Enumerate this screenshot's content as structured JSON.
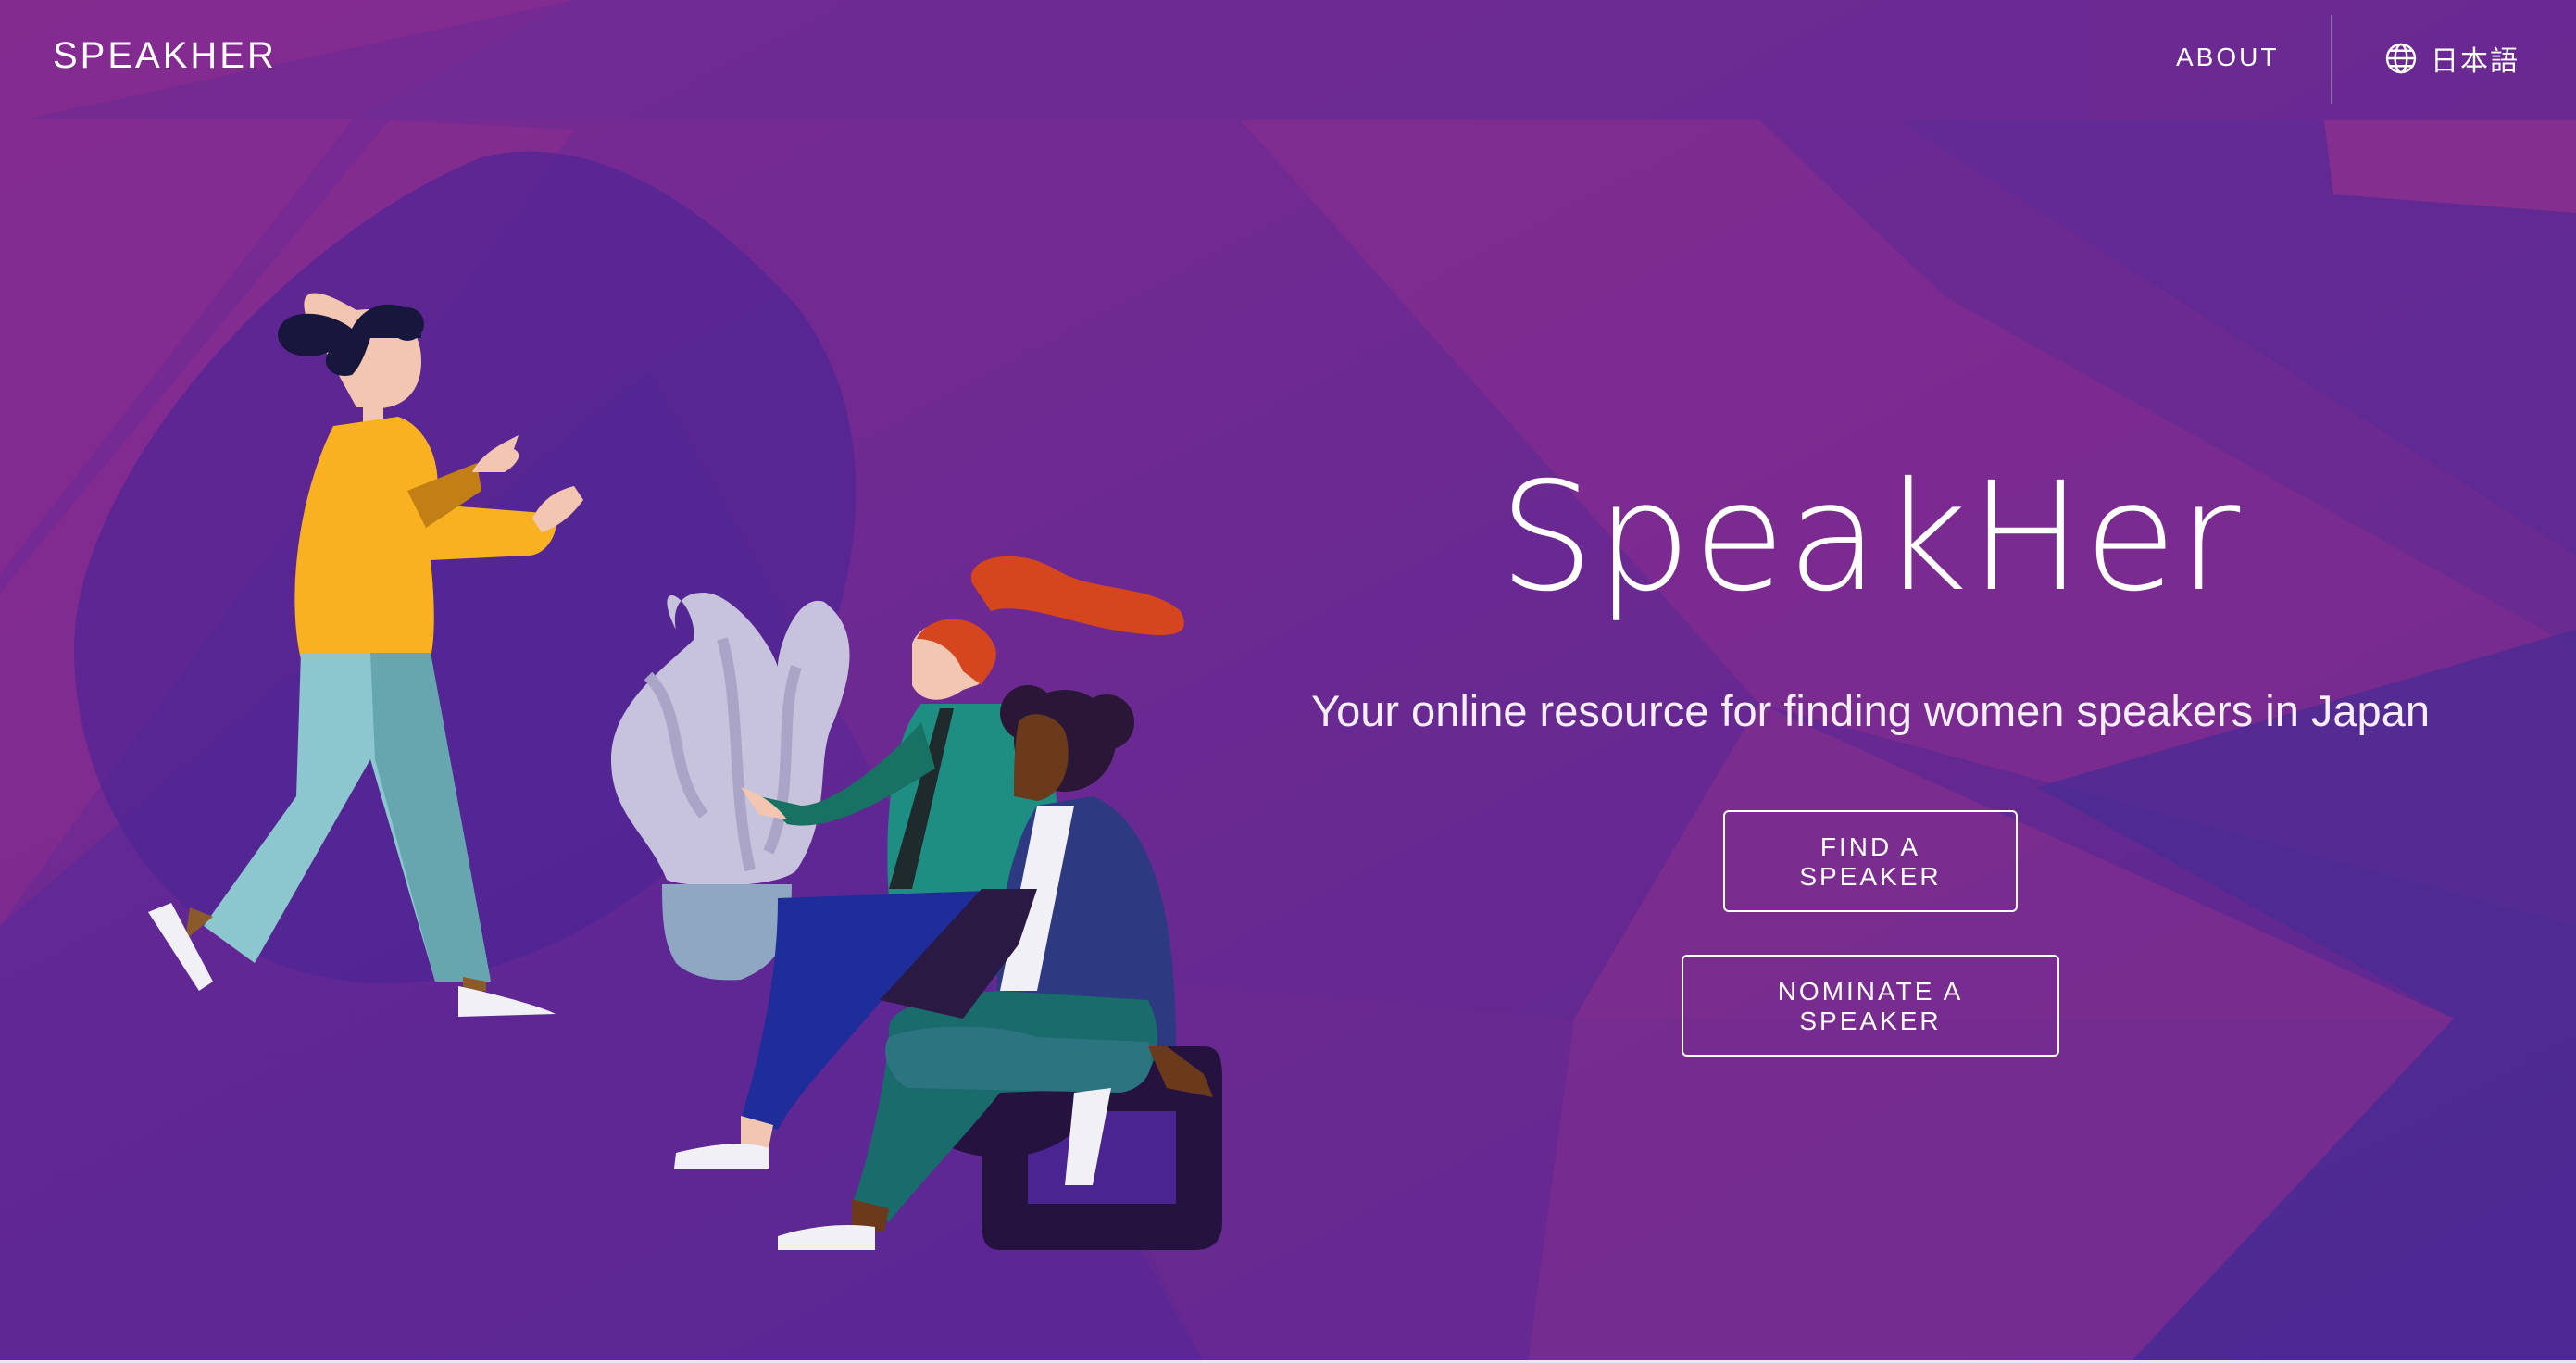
{
  "nav": {
    "brand": "SPEAKHER",
    "about_label": "ABOUT",
    "language_label": "日本語",
    "language_icon": "globe-icon"
  },
  "hero": {
    "title": "SpeakHer",
    "subtitle": "Your online resource for finding women speakers in Japan",
    "find_button": "FIND A SPEAKER",
    "nominate_button": "NOMINATE A SPEAKER"
  },
  "colors": {
    "background": "#6a2a8e",
    "accent_magenta": "#8e2f8f",
    "accent_blue": "#4b2a94",
    "button_border": "#ffffff"
  },
  "illustration": {
    "description_icon": "people-talking-illustration"
  }
}
